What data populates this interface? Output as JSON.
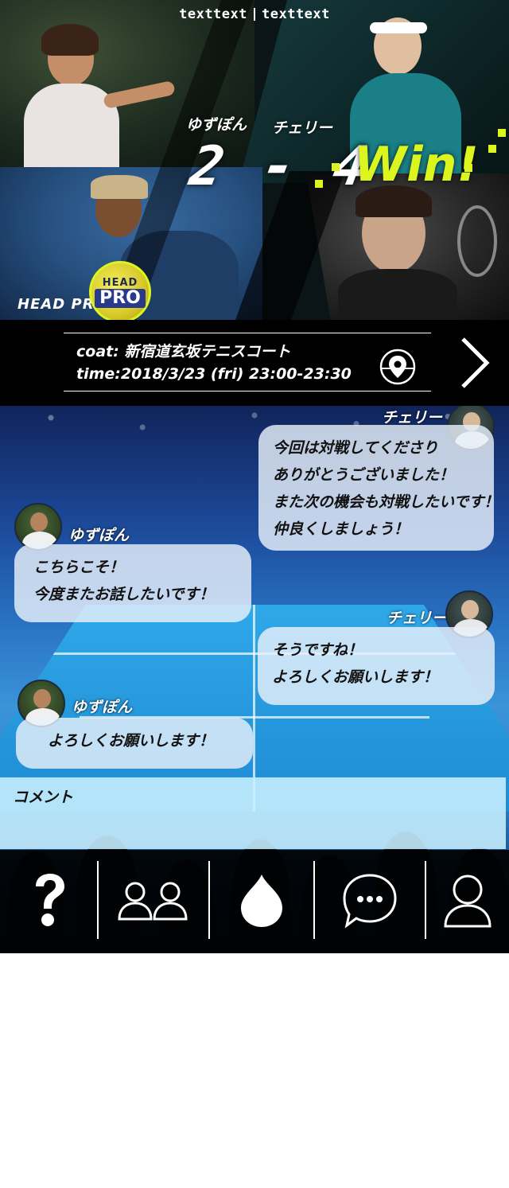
{
  "hero": {
    "header_left": "texttext",
    "header_right": "texttext",
    "player_left": "ゆずぽん",
    "player_right": "チェリー",
    "score": "2 - 4",
    "result": "Win!",
    "brand": "HEAD PRO",
    "ball_top": "HEAD",
    "ball_bottom": "PRO"
  },
  "match": {
    "coat": "coat: 新宿道玄坂テニスコート",
    "time": "time:2018/3/23 (fri) 23:00-23:30"
  },
  "chat": {
    "messages": [
      {
        "sender": "チェリー",
        "lines": [
          "今回は対戦してくださり",
          "ありがとうございました！",
          "また次の機会も対戦したいです！",
          "仲良くしましょう！"
        ]
      },
      {
        "sender": "ゆずぽん",
        "lines": [
          "こちらこそ！",
          "今度またお話したいです！"
        ]
      },
      {
        "sender": "チェリー",
        "lines": [
          "そうですね！",
          "よろしくお願いします！"
        ]
      },
      {
        "sender": "ゆずぽん",
        "lines": [
          "よろしくお願いします！"
        ]
      }
    ],
    "comment_placeholder": "コメント"
  },
  "colors": {
    "accent": "#dcf51e",
    "bubble": "#e8f0fa",
    "comment_bg": "#c8f0ff"
  },
  "tabs": [
    {
      "icon": "question-icon"
    },
    {
      "icon": "friends-icon"
    },
    {
      "icon": "flame-icon"
    },
    {
      "icon": "chat-bubble-icon"
    },
    {
      "icon": "profile-icon"
    }
  ]
}
